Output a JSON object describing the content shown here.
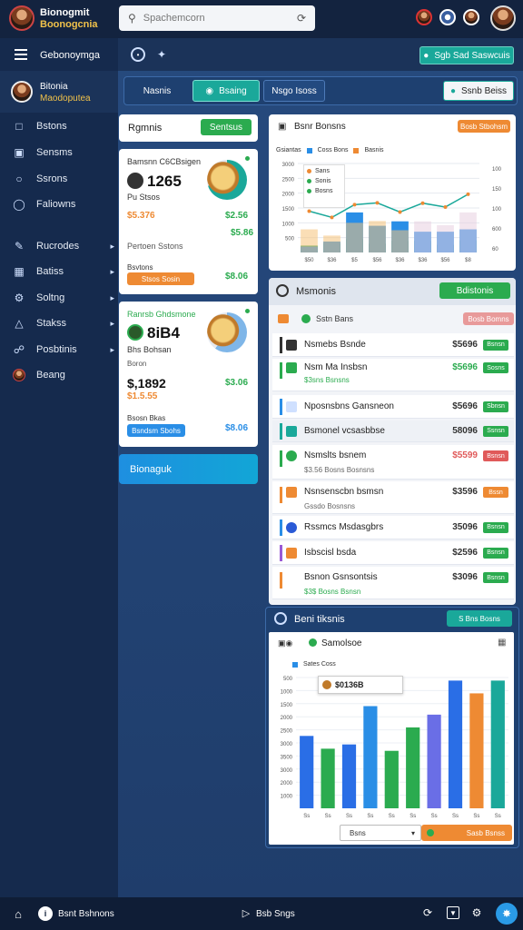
{
  "app": {
    "title_line1": "Bionogmit",
    "title_line2": "Boonogcnia"
  },
  "search": {
    "placeholder": "Spachemcorn"
  },
  "subheader": {
    "label": "Gebonoymga",
    "right_button": "Sgb Sad Saswcuis"
  },
  "user": {
    "name": "Bitonia",
    "role": "Maodoputea"
  },
  "sidebar": {
    "items": [
      {
        "label": "Bstons",
        "icon": "square-icon"
      },
      {
        "label": "Sensms",
        "icon": "calendar-icon"
      },
      {
        "label": "Ssrons",
        "icon": "circle-icon"
      },
      {
        "label": "Faliowns",
        "icon": "message-icon"
      },
      {
        "label": "Rucrodes",
        "icon": "wrench-icon"
      },
      {
        "label": "Batiss",
        "icon": "grid-icon"
      },
      {
        "label": "Soltng",
        "icon": "gear-icon"
      },
      {
        "label": "Stakss",
        "icon": "chart-icon"
      },
      {
        "label": "Posbtinis",
        "icon": "link-icon"
      },
      {
        "label": "Beang",
        "icon": "avatar-icon"
      }
    ]
  },
  "tabs": [
    {
      "label": "Nasnis"
    },
    {
      "label": "Bsaing"
    },
    {
      "label": "Nsgo Isoss"
    }
  ],
  "tabs_right_button": "Ssnb Beiss",
  "left_panel": {
    "header": "Rgmnis",
    "header_button": "Sentsus",
    "card1": {
      "title": "Bamsnn C6CBsigen",
      "amount": "1265",
      "sub": "Pu Stsos",
      "green1": "$2.56",
      "orange1": "$5.376",
      "green2": "$5.86",
      "note": "Pertoen Sstons",
      "btn_label": "Stsos Sosin",
      "small": "Bsvtons",
      "green3": "$8.06"
    },
    "card2": {
      "title": "Ranrsb Ghdsmone",
      "amount": "8iB4",
      "sub": "Bhs Bohsan",
      "sub2": "Boron",
      "amount2": "$,1892",
      "orange": "$1.5.55",
      "green": "$3.06",
      "small": "Bsosn Bkas",
      "btn_label": "Bsndsm Sbohs",
      "green2": "$8.06"
    },
    "blue_button": "Bionaguk"
  },
  "chart1": {
    "title": "Bsnr Bonsns",
    "button": "Bosb Stbohsm",
    "legend": [
      "Gsiantas",
      "Coss Bons",
      "Basnis"
    ],
    "inner_legend": [
      "Sans",
      "Sonis",
      "Bosns"
    ]
  },
  "chart_data": [
    {
      "type": "bar",
      "categories": [
        "$50",
        "$36",
        "$5",
        "$56",
        "$36",
        "$36",
        "$56",
        "$8"
      ],
      "series": [
        {
          "name": "Gsiantas",
          "values": [
            230,
            310,
            450,
            300,
            390,
            390,
            260,
            410
          ]
        },
        {
          "name": "Coss Bons",
          "values": [
            200,
            370,
            1350,
            900,
            1050,
            700,
            700,
            780
          ]
        },
        {
          "name": "Basnis",
          "values": [
            780,
            570,
            1000,
            1060,
            750,
            1050,
            920,
            1350
          ]
        }
      ],
      "y_ticks": [
        "500",
        "1000",
        "1500",
        "2000",
        "2500",
        "3000"
      ],
      "y_right": [
        "100",
        "150",
        "100",
        "600",
        "60"
      ],
      "ylim": [
        0,
        3000
      ]
    },
    {
      "type": "bar",
      "title": "Samolsoe",
      "categories": [
        "Ss",
        "Ss",
        "Ss",
        "Ss",
        "Ss",
        "Ss",
        "Ss",
        "Ss",
        "Ss",
        "Ss"
      ],
      "series": [
        {
          "name": "Sates Coss",
          "values": [
            1700,
            1400,
            1500,
            2400,
            1350,
            1900,
            2200,
            3000,
            2700,
            3000
          ]
        }
      ],
      "tooltip": "$0136B",
      "y_ticks": [
        "500",
        "1000",
        "1500",
        "2000",
        "2500",
        "3000",
        "3500",
        "3000",
        "2000",
        "1000"
      ],
      "ylim": [
        0,
        3200
      ]
    }
  ],
  "list_panel": {
    "title": "Msmonis",
    "button": "Bdistonis",
    "subhead": "Sstn Bans",
    "subhead_pill": "Bosb Bomns",
    "rows": [
      {
        "name": "Nsmebs Bsnde",
        "value": "$5696",
        "pill": "Bsnsn",
        "pill_color": "green",
        "bar_color": "#333"
      },
      {
        "name": "Nsm Ma Insbsn",
        "value": "$5696",
        "pill": "Sosns",
        "pill_color": "green",
        "bar_color": "#2bab4f",
        "sub": "$3sns  Bsnsns"
      },
      {
        "name": "Nposnsbns Gansneon",
        "value": "$5696",
        "pill": "Sbnsn",
        "pill_color": "green",
        "bar_color": "#2a8ee6",
        "sub": "Sbnsn"
      },
      {
        "name": "Bsmonel vcsasbbse",
        "value": "58096",
        "pill": "Ssnsn",
        "pill_color": "green",
        "bar_color": "#1aa89a"
      },
      {
        "name": "Nsmslts bsnem",
        "value": "$5599",
        "pill": "Bsnsn",
        "pill_color": "red",
        "bar_color": "#2bab4f",
        "sub": "$3.56  Bosns  Bosnsns"
      },
      {
        "name": "Nsnsenscbn bsmsn",
        "value": "$3596",
        "pill": "Bssn",
        "pill_color": "orange",
        "bar_color": "#ee8a33",
        "sub": "Gssdo  Bosnsns"
      },
      {
        "name": "Rssmcs Msdasgbrs",
        "value": "35096",
        "pill": "Bsnsn",
        "pill_color": "green",
        "bar_color": "#2a8ee6"
      },
      {
        "name": "Isbscisl bsda",
        "value": "$2596",
        "pill": "Bsnsn",
        "pill_color": "green",
        "bar_color": "#9a5ad6"
      },
      {
        "name": "Bsnon Gsnsontsis",
        "value": "$3096",
        "pill": "Bsnsn",
        "pill_color": "green",
        "bar_color": "#ee8a33",
        "sub": "$3$  Bosns  Bsnsn"
      }
    ]
  },
  "chart2_panel": {
    "title": "Beni tiksnis",
    "button": "S Bns Bosns",
    "select_label": "Bsns",
    "footer_button": "Sasb Bsnss"
  },
  "bottom": {
    "left": "Bsnt Bshnons",
    "middle": "Bsb Sngs"
  }
}
